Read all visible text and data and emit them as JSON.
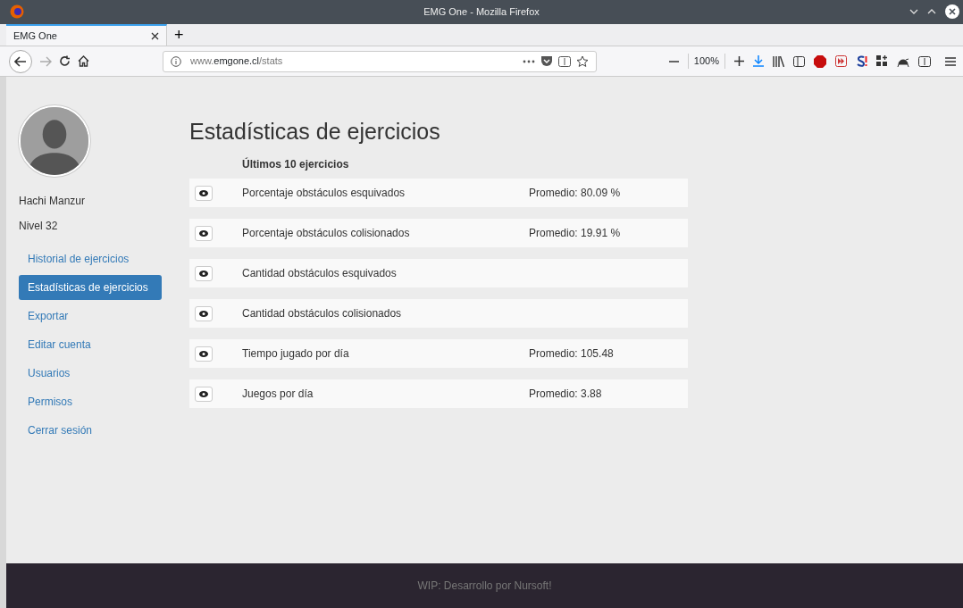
{
  "window": {
    "title": "EMG One - Mozilla Firefox"
  },
  "browser": {
    "tabs": [
      {
        "label": "EMG One",
        "selected": true
      }
    ],
    "new_tab": "+",
    "url": {
      "prefix": "www.",
      "domain": "emgone.cl",
      "path": "/stats"
    },
    "zoom": "100%"
  },
  "user": {
    "name": "Hachi Manzur",
    "level": "Nivel 32"
  },
  "nav": [
    {
      "label": "Historial de ejercicios",
      "selected": false
    },
    {
      "label": "Estadísticas de ejercicios",
      "selected": true
    },
    {
      "label": "Exportar",
      "selected": false
    },
    {
      "label": "Editar cuenta",
      "selected": false
    },
    {
      "label": "Usuarios",
      "selected": false
    },
    {
      "label": "Permisos",
      "selected": false
    },
    {
      "label": "Cerrar sesión",
      "selected": false
    }
  ],
  "main": {
    "title": "Estadísticas de ejercicios",
    "subtitle": "Últimos 10 ejercicios",
    "rows": [
      {
        "name": "Porcentaje obstáculos esquivados",
        "average": "Promedio: 80.09 %"
      },
      {
        "name": "Porcentaje obstáculos colisionados",
        "average": "Promedio: 19.91 %"
      },
      {
        "name": "Cantidad obstáculos esquivados"
      },
      {
        "name": "Cantidad obstáculos colisionados"
      },
      {
        "name": "Tiempo jugado por día",
        "average": "Promedio: 105.48"
      },
      {
        "name": "Juegos por día",
        "average": "Promedio: 3.88"
      }
    ]
  },
  "footer": "WIP: Desarrollo por Nursoft!"
}
